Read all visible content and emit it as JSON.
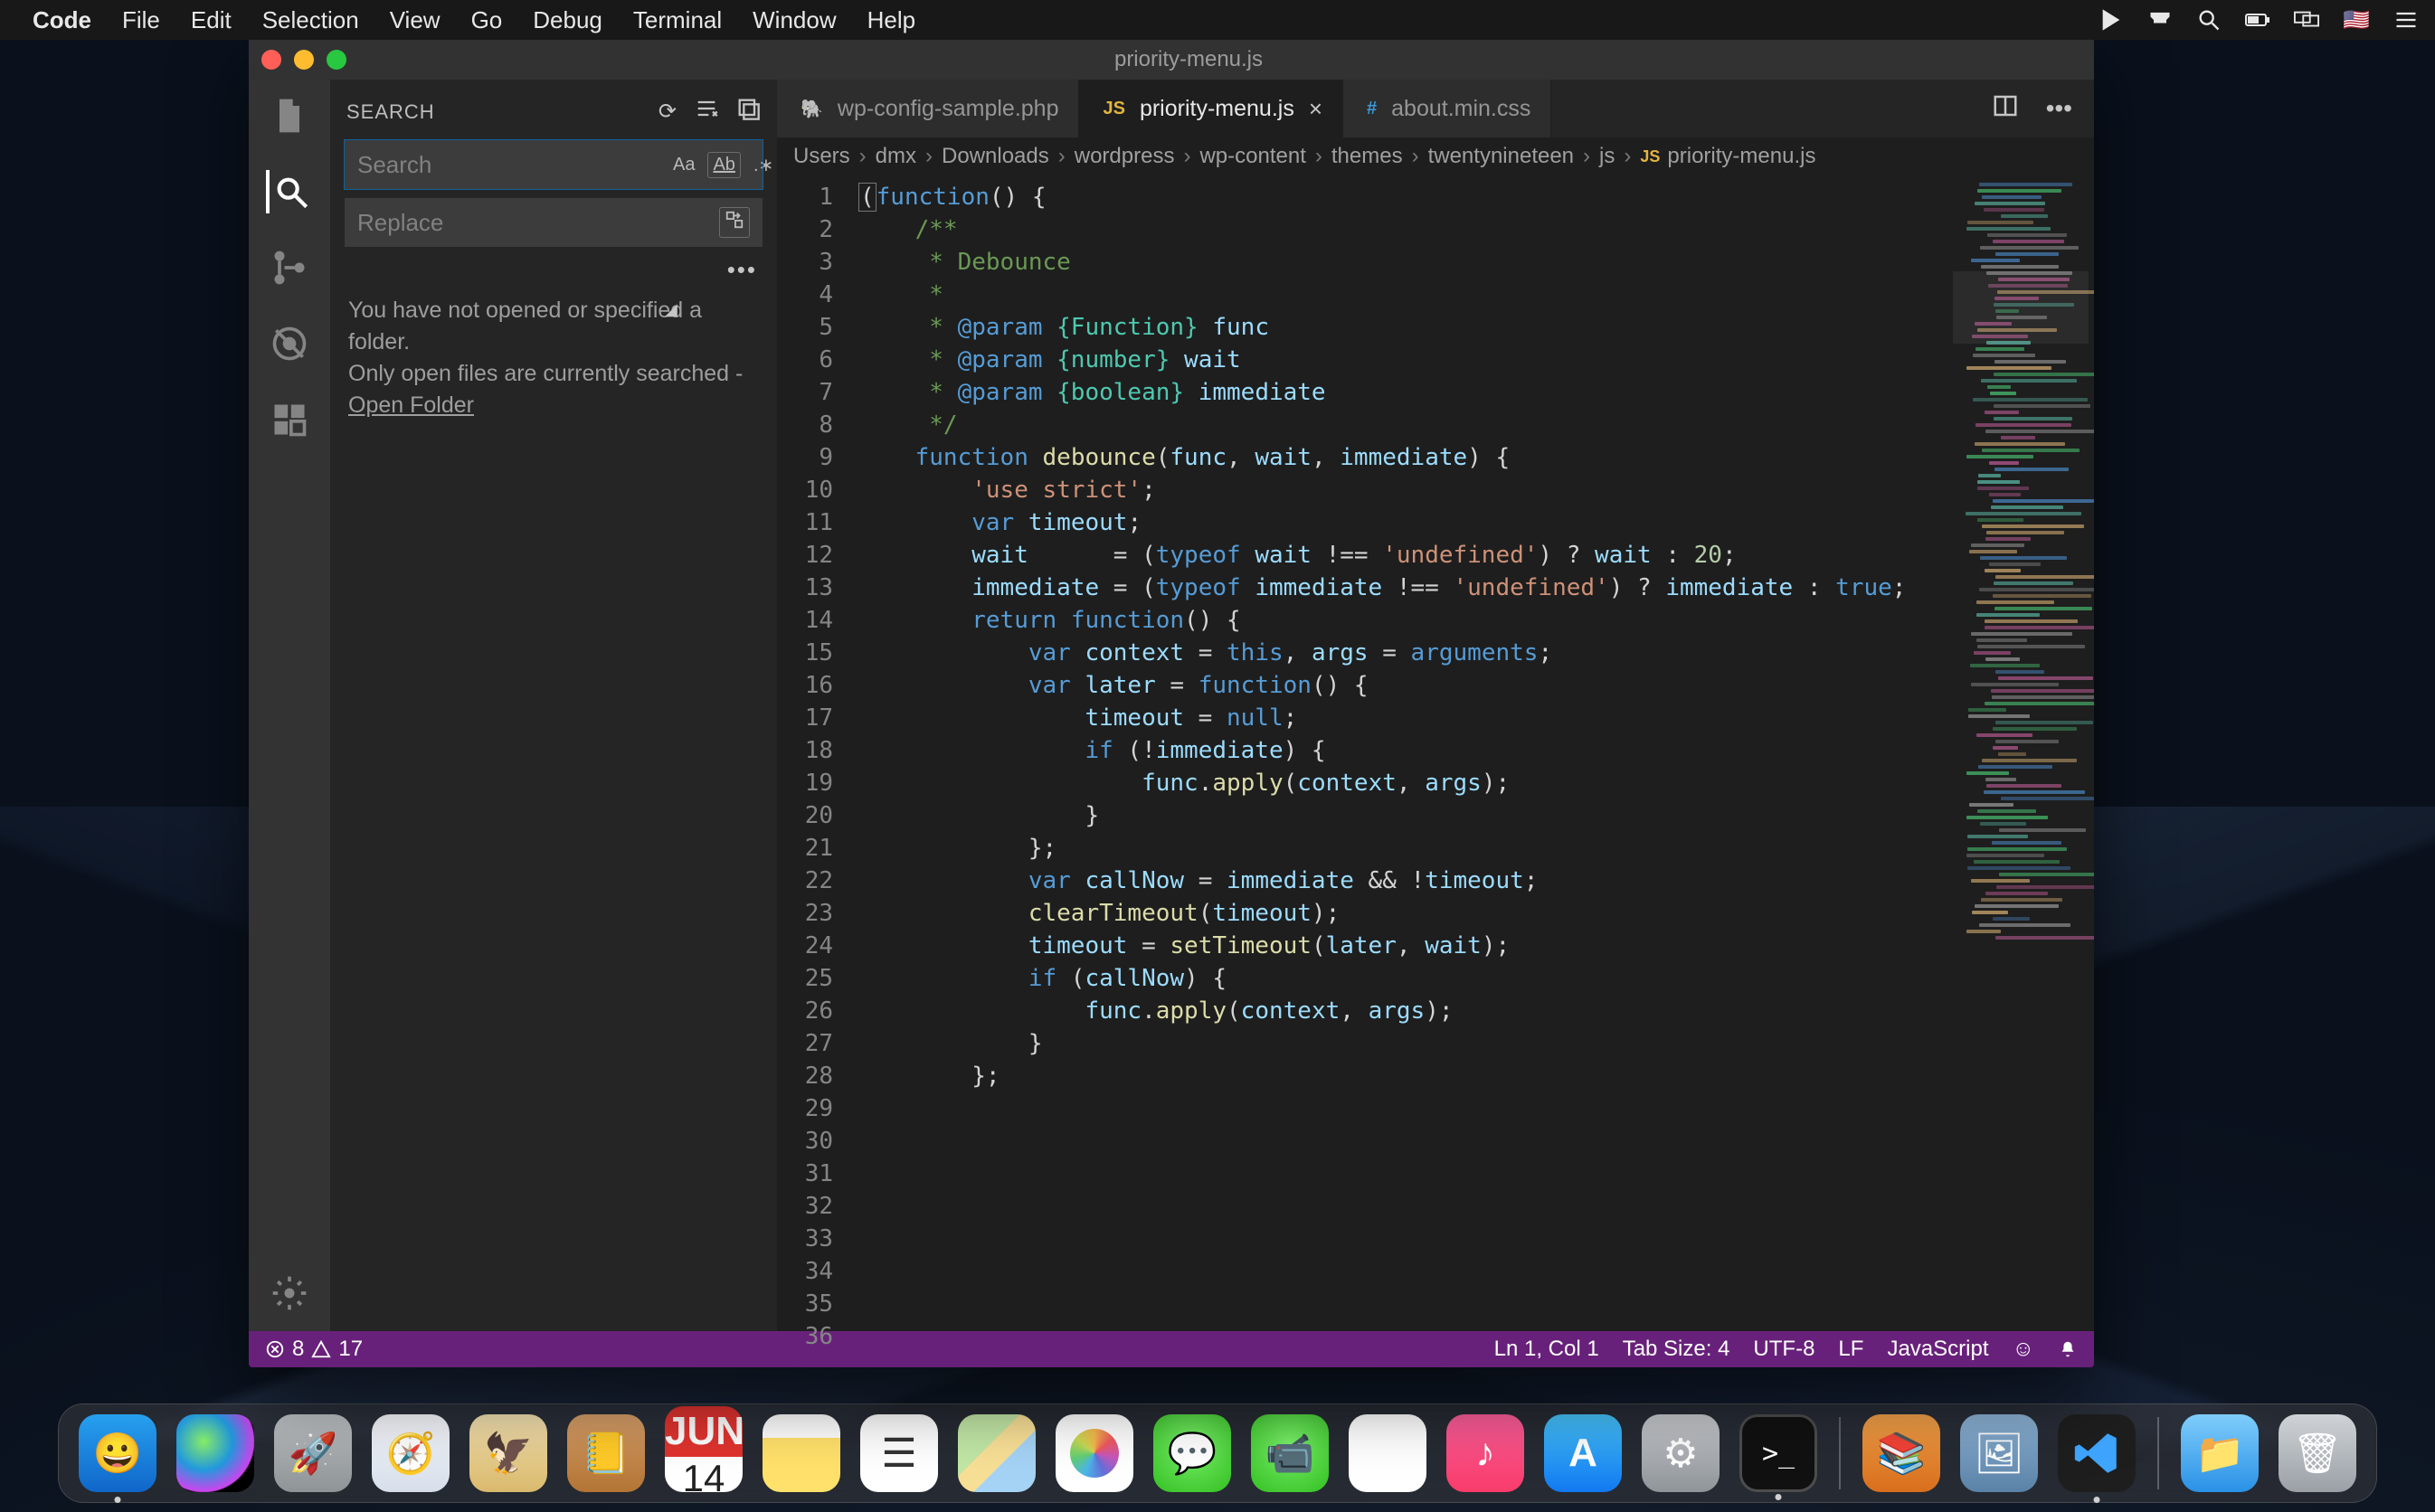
{
  "menubar": {
    "app_name": "Code",
    "items": [
      "File",
      "Edit",
      "Selection",
      "View",
      "Go",
      "Debug",
      "Terminal",
      "Window",
      "Help"
    ]
  },
  "window": {
    "title": "priority-menu.js"
  },
  "activitybar": {
    "items": [
      "files-icon",
      "search-icon",
      "git-icon",
      "debug-icon",
      "extensions-icon"
    ],
    "bottom": [
      "settings-icon"
    ],
    "active": "search-icon"
  },
  "search_panel": {
    "title": "SEARCH",
    "search_placeholder": "Search",
    "replace_placeholder": "Replace",
    "hint_line1": "You have not opened or specified a folder.",
    "hint_line2": "Only open files are currently searched -",
    "open_folder": "Open Folder"
  },
  "tabs": [
    {
      "icon": "php",
      "iconGlyph": "🐘",
      "label": "wp-config-sample.php",
      "active": false,
      "dirty": false
    },
    {
      "icon": "js",
      "iconGlyph": "JS",
      "label": "priority-menu.js",
      "active": true,
      "dirty": false,
      "closeable": true
    },
    {
      "icon": "css",
      "iconGlyph": "#",
      "label": "about.min.css",
      "active": false,
      "dirty": false
    }
  ],
  "breadcrumbs": [
    "Users",
    "dmx",
    "Downloads",
    "wordpress",
    "wp-content",
    "themes",
    "twentynineteen",
    "js",
    "priority-menu.js"
  ],
  "code_lines": [
    "(function() {",
    "",
    "    /**",
    "     * Debounce",
    "     *",
    "     * @param {Function} func",
    "     * @param {number} wait",
    "     * @param {boolean} immediate",
    "     */",
    "    function debounce(func, wait, immediate) {",
    "        'use strict';",
    "",
    "        var timeout;",
    "        wait      = (typeof wait !== 'undefined') ? wait : 20;",
    "        immediate = (typeof immediate !== 'undefined') ? immediate : true;",
    "",
    "        return function() {",
    "",
    "            var context = this, args = arguments;",
    "            var later = function() {",
    "                timeout = null;",
    "",
    "                if (!immediate) {",
    "                    func.apply(context, args);",
    "                }",
    "            };",
    "",
    "            var callNow = immediate && !timeout;",
    "",
    "            clearTimeout(timeout);",
    "            timeout = setTimeout(later, wait);",
    "",
    "            if (callNow) {",
    "                func.apply(context, args);",
    "            }",
    "        };"
  ],
  "statusbar": {
    "errors": "8",
    "warnings": "17",
    "position": "Ln 1, Col 1",
    "tabsize": "Tab Size: 4",
    "encoding": "UTF-8",
    "eol": "LF",
    "language": "JavaScript"
  },
  "calendar": {
    "month": "JUN",
    "day": "14"
  },
  "dock_apps": [
    "finder",
    "siri",
    "launchpad",
    "safari",
    "mail",
    "contacts",
    "calendar",
    "notes",
    "reminders",
    "maps",
    "photos",
    "messages",
    "facetime",
    "news",
    "music",
    "appstore",
    "preferences",
    "terminal"
  ],
  "dock_right": [
    "books",
    "photosapp",
    "vscode"
  ],
  "dock_far": [
    "downloads",
    "trash"
  ]
}
